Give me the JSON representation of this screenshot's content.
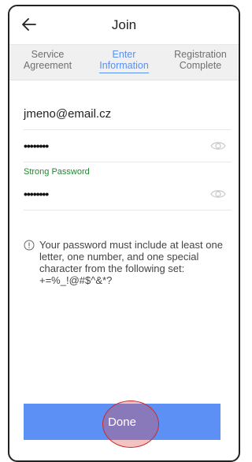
{
  "header": {
    "title": "Join",
    "back_icon": "arrow-left-icon"
  },
  "steps": [
    {
      "line1": "Service",
      "line2": "Agreement",
      "active": false
    },
    {
      "line1": "Enter",
      "line2": "Information",
      "active": true
    },
    {
      "line1": "Registration",
      "line2": "Complete",
      "active": false
    }
  ],
  "form": {
    "email": "jmeno@email.cz",
    "password": "••••••••",
    "password_strength": "Strong Password",
    "confirm_password": "••••••••"
  },
  "info": {
    "icon": "info-circle-icon",
    "text": "Your password must include at least one letter, one number, and one special character from the following set: +=%_!@#$^&*?"
  },
  "actions": {
    "done_label": "Done"
  },
  "colors": {
    "accent": "#5b8ff0",
    "done_button": "#5c90f5",
    "strong": "#1e8a2e",
    "tap_highlight": "#c92b2b"
  }
}
